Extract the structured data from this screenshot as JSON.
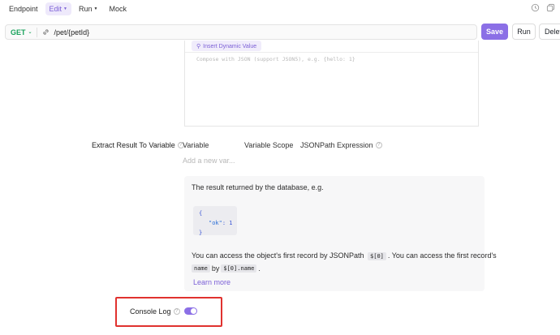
{
  "tabs": [
    {
      "label": "Endpoint",
      "active": false,
      "caret": false
    },
    {
      "label": "Edit",
      "active": true,
      "caret": true
    },
    {
      "label": "Run",
      "active": false,
      "caret": true
    },
    {
      "label": "Mock",
      "active": false,
      "caret": false
    }
  ],
  "header_icons": [
    "history-icon",
    "copy-icon"
  ],
  "request": {
    "method": "GET",
    "path": "/pet/{petId}",
    "save_label": "Save",
    "run_label": "Run",
    "delete_label": "Delete"
  },
  "editor": {
    "dynamic_value_label": "Insert Dynamic Value",
    "placeholder": "Compose with JSON (support JSON5), e.g. {hello: 1}"
  },
  "extract": {
    "label": "Extract Result To Variable",
    "columns": [
      "Variable",
      "Variable Scope",
      "JSONPath Expression"
    ],
    "add_placeholder": "Add a new var..."
  },
  "info": {
    "intro": "The result returned by the database, e.g.",
    "code": {
      "open": "{",
      "key": "\"ok\"",
      "value": "1",
      "close": "}"
    },
    "line2_pre": "You can access the object's first record by JSONPath",
    "line2_chip": "$[0]",
    "line2_post": ". You can access the first record's",
    "line3_chip1": "name",
    "line3_mid": "by",
    "line3_chip2": "$[0].name",
    "line3_post": ".",
    "learn_more": "Learn more"
  },
  "console_log": {
    "label": "Console Log",
    "enabled": true
  },
  "colors": {
    "accent": "#8b6fe6",
    "method_get": "#1aa35c",
    "highlight_frame": "#e0322f"
  }
}
